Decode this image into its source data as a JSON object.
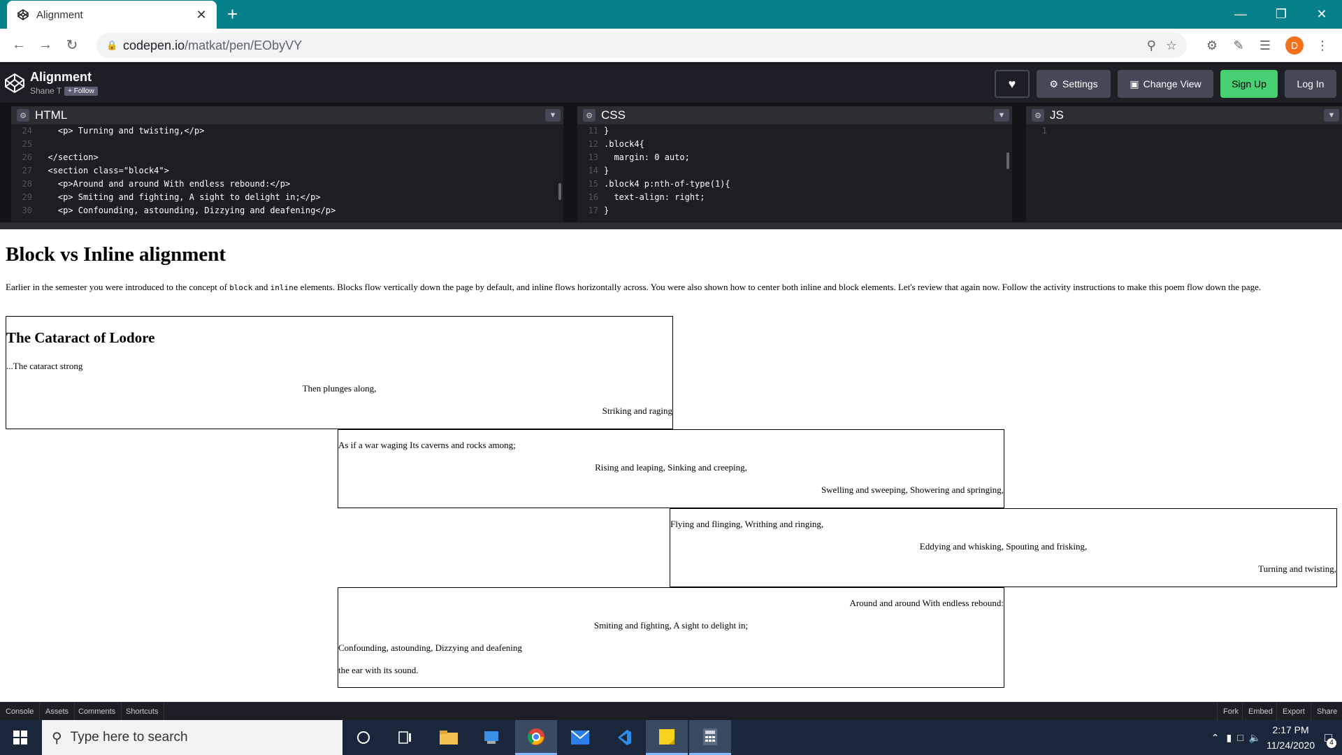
{
  "browser": {
    "tab_title": "Alignment",
    "url_host": "codepen.io",
    "url_path": "/matkat/pen/EObyVY",
    "avatar_letter": "D"
  },
  "codepen": {
    "pen_title": "Alignment",
    "author": "Shane T",
    "follow_label": "+ Follow",
    "settings_label": "Settings",
    "change_view_label": "Change View",
    "signup_label": "Sign Up",
    "login_label": "Log In",
    "accent_green": "#47cf73",
    "editors": {
      "html_label": "HTML",
      "css_label": "CSS",
      "js_label": "JS",
      "html_lines": [
        {
          "n": "24",
          "t": "    <p> Turning and twisting,</p>"
        },
        {
          "n": "25",
          "t": ""
        },
        {
          "n": "26",
          "t": "  </section>"
        },
        {
          "n": "27",
          "t": "  <section class=\"block4\">"
        },
        {
          "n": "28",
          "t": "    <p>Around and around With endless rebound:</p>"
        },
        {
          "n": "29",
          "t": "    <p> Smiting and fighting, A sight to delight in;</p>"
        },
        {
          "n": "30",
          "t": "    <p> Confounding, astounding, Dizzying and deafening</p>"
        }
      ],
      "css_lines": [
        {
          "n": "11",
          "t": "}"
        },
        {
          "n": "12",
          "t": ".block4{"
        },
        {
          "n": "13",
          "t": "  margin: 0 auto;"
        },
        {
          "n": "14",
          "t": "}"
        },
        {
          "n": "15",
          "t": ".block4 p:nth-of-type(1){"
        },
        {
          "n": "16",
          "t": "  text-align: right;"
        },
        {
          "n": "17",
          "t": "}"
        }
      ],
      "js_lines": [
        {
          "n": "1",
          "t": ""
        }
      ]
    },
    "footer": {
      "console": "Console",
      "assets": "Assets",
      "comments": "Comments",
      "shortcuts": "Shortcuts",
      "fork": "Fork",
      "embed": "Embed",
      "export": "Export",
      "share": "Share"
    }
  },
  "result": {
    "heading": "Block vs Inline alignment",
    "intro_1": "Earlier in the semester you were introduced to the concept of ",
    "intro_code1": "block",
    "intro_2": " and ",
    "intro_code2": "inline",
    "intro_3": " elements. Blocks flow vertically down the page by default, and inline flows horizontally across. You were also shown how to center both inline and block elements. Let's review that again now. Follow the activity instructions to make this poem flow down the page.",
    "block1": {
      "title": "The Cataract of Lodore",
      "lines": [
        "...The cataract strong",
        "Then plunges along,",
        "Striking and raging"
      ]
    },
    "block2": {
      "lines": [
        "As if a war waging Its caverns and rocks among;",
        "Rising and leaping, Sinking and creeping,",
        "Swelling and sweeping, Showering and springing,"
      ]
    },
    "block3": {
      "lines": [
        "Flying and flinging, Writhing and ringing,",
        "Eddying and whisking, Spouting and frisking,",
        "Turning and twisting,"
      ]
    },
    "block4": {
      "lines": [
        "Around and around With endless rebound:",
        "Smiting and fighting, A sight to delight in;",
        "Confounding, astounding, Dizzying and deafening",
        "the ear with its sound."
      ]
    }
  },
  "taskbar": {
    "search_placeholder": "Type here to search",
    "time": "2:17 PM",
    "date": "11/24/2020",
    "notifications": "4"
  }
}
